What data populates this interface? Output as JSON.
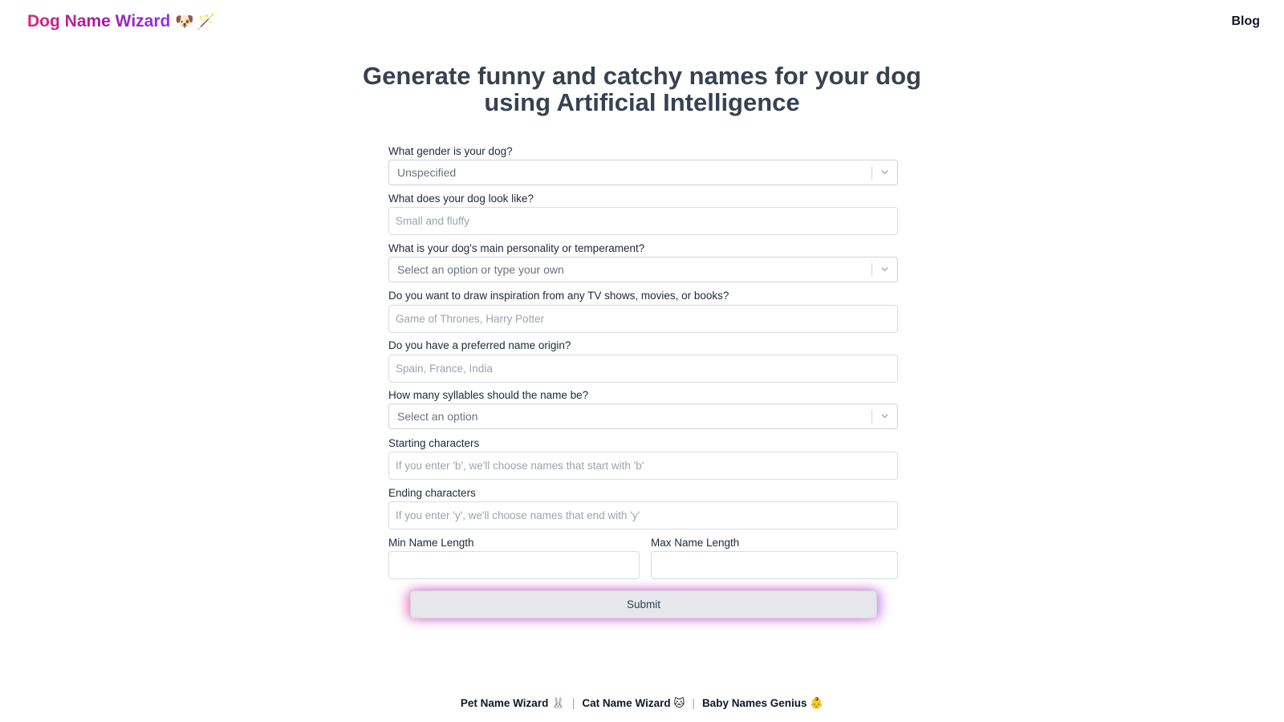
{
  "header": {
    "brand": "Dog Name Wizard",
    "brand_emoji_dog": "🐶",
    "brand_emoji_wand": "🪄",
    "blog_link": "Blog"
  },
  "headline": "Generate funny and catchy names for your dog using Artificial Intelligence",
  "form": {
    "gender": {
      "label": "What gender is your dog?",
      "value": "Unspecified"
    },
    "looks": {
      "label": "What does your dog look like?",
      "placeholder": "Small and fluffy"
    },
    "personality": {
      "label": "What is your dog's main personality or temperament?",
      "value": "Select an option or type your own"
    },
    "inspiration": {
      "label": "Do you want to draw inspiration from any TV shows, movies, or books?",
      "placeholder": "Game of Thrones, Harry Potter"
    },
    "origin": {
      "label": "Do you have a preferred name origin?",
      "placeholder": "Spain, France, India"
    },
    "syllables": {
      "label": "How many syllables should the name be?",
      "value": "Select an option"
    },
    "starting": {
      "label": "Starting characters",
      "placeholder": "If you enter 'b', we'll choose names that start with 'b'"
    },
    "ending": {
      "label": "Ending characters",
      "placeholder": "If you enter 'y', we'll choose names that end with 'y'"
    },
    "min_length": {
      "label": "Min Name Length",
      "value": ""
    },
    "max_length": {
      "label": "Max Name Length",
      "value": ""
    },
    "submit_label": "Submit"
  },
  "footer": {
    "links": [
      {
        "label": "Pet Name Wizard",
        "emoji": "🐰"
      },
      {
        "label": "Cat Name Wizard",
        "emoji": "🐱"
      },
      {
        "label": "Baby Names Genius",
        "emoji": "👶"
      }
    ],
    "separator": "|"
  },
  "colors": {
    "brand_gradient_start": "#db2777",
    "brand_gradient_end": "#9333ea",
    "headline": "#374151",
    "submit_bg": "#e5e7eb"
  }
}
